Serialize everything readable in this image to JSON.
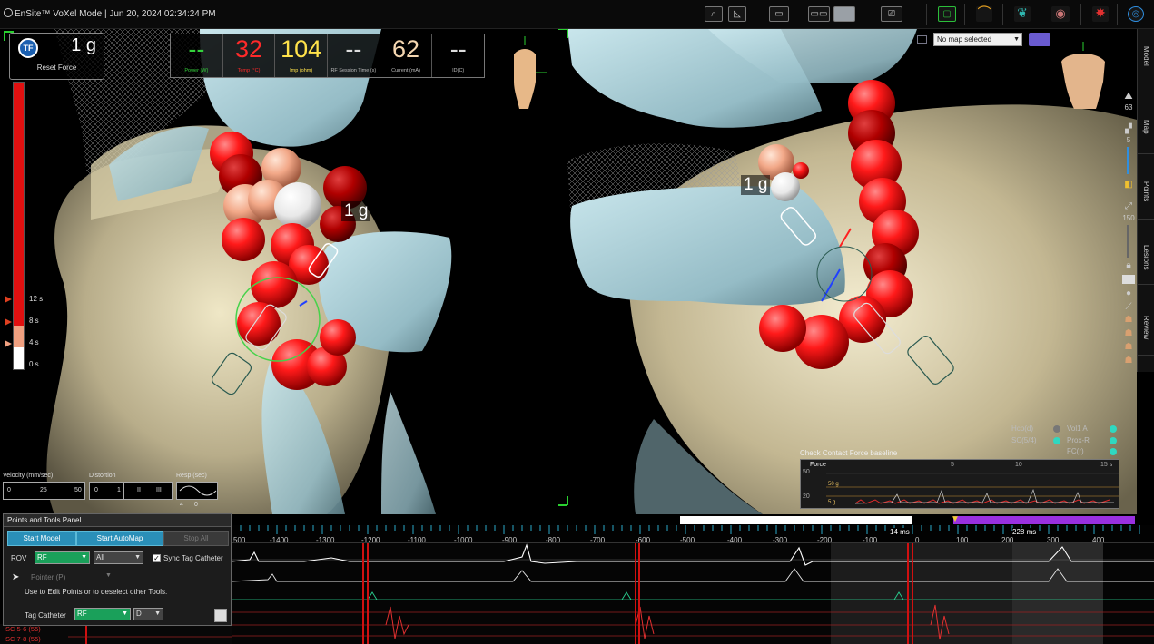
{
  "topbar": {
    "brand": "EnSite™ VoXel Mode |",
    "datetime": "Jun 20, 2024 02:34:24 PM"
  },
  "force_panel": {
    "logo": "TF",
    "value": "1 g",
    "reset_label": "Reset Force",
    "ticks": [
      "12 s",
      "8 s",
      "4 s",
      "0 s"
    ]
  },
  "rf_panel": {
    "cells": [
      {
        "value": "--",
        "label": "Power (W)",
        "color": "#34d23c"
      },
      {
        "value": "32",
        "label": "Temp (°C)",
        "color": "#ff2a2a"
      },
      {
        "value": "104",
        "label": "Imp (ohm)",
        "color": "#ffe24a"
      },
      {
        "value": "--",
        "label": "RF Session Time (s)",
        "color": "#ffffff"
      },
      {
        "value": "62",
        "label": "Current (mA)",
        "color": "#f4d6b0"
      },
      {
        "value": "--",
        "label": "ID(C)",
        "color": "#ffffff"
      }
    ]
  },
  "views": {
    "left_force_label": "1 g",
    "right_force_label": "1 g"
  },
  "map": {
    "selected": "No map selected"
  },
  "sidebar": {
    "tabs": [
      "Model",
      "Map",
      "Points",
      "Lesions",
      "Review"
    ],
    "readouts": [
      "63",
      "5",
      "150"
    ]
  },
  "gauges": {
    "velocity_label": "Velocity (mm/sec)",
    "velocity_ticks": [
      "0",
      "25",
      "50"
    ],
    "distortion_label": "Distortion",
    "distortion_ticks": [
      "0",
      "1",
      "II",
      "III"
    ],
    "resp_label": "Resp (sec)",
    "resp_ticks": [
      "4",
      "0"
    ]
  },
  "contact_force": {
    "title": "Check Contact Force baseline",
    "chart_label": "Force",
    "y_ticks": [
      "50 g",
      "5 g"
    ],
    "left_ticks": [
      "50",
      "20"
    ],
    "x_ticks": [
      "5",
      "10",
      "15 s"
    ]
  },
  "legend": {
    "left": [
      "Hcp(d)",
      "SC(5/4)"
    ],
    "right": [
      "Vol1 A",
      "Prox-R",
      "FC(r)"
    ]
  },
  "timeline": {
    "ms_1": "14 ms",
    "ms_2": "228 ms",
    "ticks": [
      "500",
      "-1400",
      "-1300",
      "-1200",
      "-1100",
      "-1000",
      "-900",
      "-800",
      "-700",
      "-600",
      "-500",
      "-400",
      "-300",
      "-200",
      "-100",
      "0",
      "100",
      "200",
      "300",
      "400"
    ]
  },
  "left_labels": [
    "SC 5-6 (55)",
    "SC 7-8 (55)"
  ],
  "points_panel": {
    "title": "Points and Tools Panel",
    "start_model": "Start Model",
    "start_automap": "Start AutoMap",
    "stop_all": "Stop All",
    "rov_label": "ROV",
    "rov_value": "RF",
    "all_value": "All",
    "sync_label": "Sync Tag Catheter",
    "pointer_label": "Pointer (P)",
    "hint": "Use to Edit Points or to deselect other Tools.",
    "tag_label": "Tag Catheter",
    "tag_value": "RF",
    "tag_sub": "D"
  }
}
